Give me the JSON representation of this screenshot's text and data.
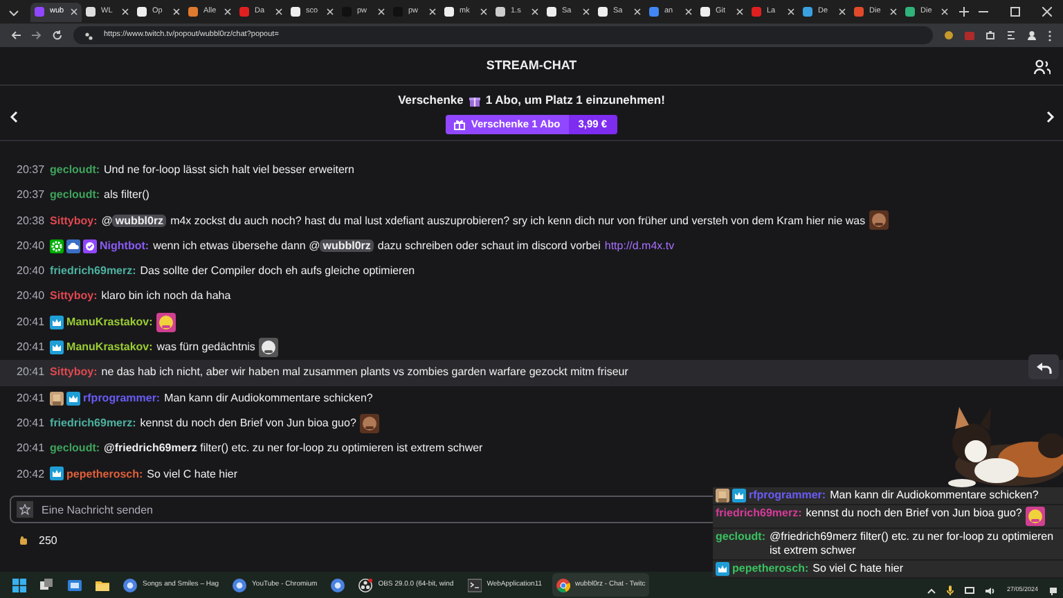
{
  "browser": {
    "tabs": [
      {
        "label": "wub",
        "selected": true,
        "color": "#9147ff"
      },
      {
        "label": "WL",
        "selected": false,
        "color": "#dddddd"
      },
      {
        "label": "Op",
        "selected": false,
        "color": "#eeeeee"
      },
      {
        "label": "Alle",
        "selected": false,
        "color": "#e07a2e"
      },
      {
        "label": "Da",
        "selected": false,
        "color": "#e02020"
      },
      {
        "label": "sco",
        "selected": false,
        "color": "#eeeeee"
      },
      {
        "label": "pw",
        "selected": false,
        "color": "#111111"
      },
      {
        "label": "pw",
        "selected": false,
        "color": "#111111"
      },
      {
        "label": "mk",
        "selected": false,
        "color": "#eeeeee"
      },
      {
        "label": "1.s",
        "selected": false,
        "color": "#cccccc"
      },
      {
        "label": "Sa",
        "selected": false,
        "color": "#eeeeee"
      },
      {
        "label": "Sa",
        "selected": false,
        "color": "#eeeeee"
      },
      {
        "label": "an",
        "selected": false,
        "color": "#4285f4"
      },
      {
        "label": "Git",
        "selected": false,
        "color": "#eeeeee"
      },
      {
        "label": "La",
        "selected": false,
        "color": "#e02020"
      },
      {
        "label": "De",
        "selected": false,
        "color": "#3aa0e0"
      },
      {
        "label": "Die",
        "selected": false,
        "color": "#e04a2a"
      },
      {
        "label": "Die",
        "selected": false,
        "color": "#2fb37a"
      }
    ],
    "address": "https://www.twitch.tv/popout/wubbl0rz/chat?popout="
  },
  "header": {
    "title": "STREAM-CHAT"
  },
  "banner": {
    "text_before": "Verschenke",
    "text_after": "1 Abo, um Platz 1 einzunehmen!",
    "button": "Verschenke 1 Abo",
    "price": "3,99 €"
  },
  "messages": [
    {
      "time": "20:37",
      "user": "gecloudt:",
      "color": "#3fa45b",
      "highlighted": false,
      "parts": [
        {
          "kind": "text",
          "text": "Und ne for-loop lässt sich halt viel besser erweitern"
        }
      ]
    },
    {
      "time": "20:37",
      "user": "gecloudt:",
      "color": "#3fa45b",
      "highlighted": false,
      "parts": [
        {
          "kind": "text",
          "text": "als filter()"
        }
      ]
    },
    {
      "time": "20:38",
      "user": "Sittyboy:",
      "color": "#e0484f",
      "highlighted": false,
      "parts": [
        {
          "kind": "text",
          "text": "@"
        },
        {
          "kind": "mention",
          "text": "wubbl0rz"
        },
        {
          "kind": "text",
          "text": "m4x zockst du auch noch? hast du mal lust xdefiant auszuprobieren? sry ich kenn dich nur von früher und versteh von dem Kram hier nie was"
        },
        {
          "kind": "emote"
        }
      ]
    },
    {
      "time": "20:40",
      "badges": [
        {
          "kind": "gear"
        },
        {
          "kind": "cloud"
        },
        {
          "kind": "verified"
        }
      ],
      "user": "Nightbot:",
      "color": "#8a5cf5",
      "highlighted": false,
      "parts": [
        {
          "kind": "text",
          "text": "wenn ich etwas übersehe dann @"
        },
        {
          "kind": "mention",
          "text": "wubbl0rz"
        },
        {
          "kind": "text",
          "text": "dazu schreiben oder schaut im discord vorbei"
        },
        {
          "kind": "link",
          "text": "http://d.m4x.tv"
        }
      ]
    },
    {
      "time": "20:40",
      "user": "friedrich69merz:",
      "color": "#4db3a0",
      "highlighted": false,
      "parts": [
        {
          "kind": "text",
          "text": "Das sollte der Compiler doch eh aufs gleiche optimieren"
        }
      ]
    },
    {
      "time": "20:40",
      "user": "Sittyboy:",
      "color": "#e0484f",
      "highlighted": false,
      "parts": [
        {
          "kind": "text",
          "text": "klaro bin ich noch da haha"
        }
      ]
    },
    {
      "time": "20:41",
      "badges": [
        {
          "kind": "crown"
        }
      ],
      "user": "ManuKrastakov:",
      "color": "#9acd32",
      "highlighted": false,
      "parts": [
        {
          "kind": "emote"
        }
      ]
    },
    {
      "time": "20:41",
      "badges": [
        {
          "kind": "crown"
        }
      ],
      "user": "ManuKrastakov:",
      "color": "#9acd32",
      "highlighted": false,
      "parts": [
        {
          "kind": "text",
          "text": "was fürn gedächtnis"
        },
        {
          "kind": "emote"
        }
      ]
    },
    {
      "time": "20:41",
      "user": "Sittyboy:",
      "color": "#e0484f",
      "highlighted": true,
      "parts": [
        {
          "kind": "text",
          "text": "ne das hab ich nicht, aber wir haben mal zusammen plants vs zombies garden warfare gezockt mitm friseur"
        }
      ]
    },
    {
      "time": "20:41",
      "badges": [
        {
          "kind": "avatar"
        },
        {
          "kind": "crown"
        }
      ],
      "user": "rfprogrammer:",
      "color": "#6a5cf5",
      "highlighted": false,
      "parts": [
        {
          "kind": "text",
          "text": "Man kann dir Audiokommentare schicken?"
        }
      ]
    },
    {
      "time": "20:41",
      "user": "friedrich69merz:",
      "color": "#4db3a0",
      "highlighted": false,
      "parts": [
        {
          "kind": "text",
          "text": "kennst du noch den Brief von Jun bioa guo?"
        },
        {
          "kind": "emote"
        }
      ]
    },
    {
      "time": "20:41",
      "user": "gecloudt:",
      "color": "#3fa45b",
      "highlighted": false,
      "parts": [
        {
          "kind": "text",
          "text": "**@friedrich69merz** filter() etc. zu ner for-loop zu optimieren ist extrem schwer"
        }
      ]
    },
    {
      "time": "20:42",
      "badges": [
        {
          "kind": "crown"
        }
      ],
      "user": "pepetherosch:",
      "color": "#e0603a",
      "highlighted": false,
      "parts": [
        {
          "kind": "text",
          "text": "So viel C hate hier"
        }
      ]
    }
  ],
  "input": {
    "placeholder": "Eine Nachricht senden"
  },
  "points": "250",
  "overlay": {
    "messages": [
      {
        "badges": [
          {
            "kind": "avatar"
          },
          {
            "kind": "crown"
          }
        ],
        "user": "rfprogrammer:",
        "color": "#6a5cf5",
        "parts": [
          {
            "kind": "text",
            "text": "Man kann dir Audiokommentare schicken?"
          }
        ]
      },
      {
        "user": "friedrich69merz:",
        "color": "#d63b9a",
        "parts": [
          {
            "kind": "text",
            "text": "kennst du noch den Brief von Jun bioa guo?"
          },
          {
            "kind": "emote"
          }
        ]
      },
      {
        "user": "gecloudt:",
        "color": "#39c15f",
        "parts": [
          {
            "kind": "text",
            "text": "@friedrich69merz filter() etc. zu ner for-loop zu optimieren ist extrem schwer"
          }
        ]
      },
      {
        "badges": [
          {
            "kind": "crown"
          }
        ],
        "user": "pepetherosch:",
        "color": "#39c15f",
        "parts": [
          {
            "kind": "text",
            "text": "So viel C hate hier"
          }
        ]
      }
    ]
  },
  "taskbar": {
    "items": [
      {
        "kind": "start"
      },
      {
        "kind": "taskview"
      },
      {
        "kind": "widgets"
      },
      {
        "kind": "explorer"
      },
      {
        "kind": "chromium",
        "label": "Songs and Smiles – Hag",
        "active": false
      },
      {
        "kind": "chromium",
        "label": "YouTube - Chromium",
        "active": false
      },
      {
        "kind": "chromium",
        "active": false
      },
      {
        "kind": "obs",
        "label": "OBS 29.0.0 (64-bit, wind",
        "active": false
      },
      {
        "kind": "terminal",
        "label": "WebApplication11",
        "active": false
      },
      {
        "kind": "chrome",
        "label": "wubbl0rz - Chat - Twitc",
        "active": true
      }
    ],
    "date": "27/05/2024"
  }
}
